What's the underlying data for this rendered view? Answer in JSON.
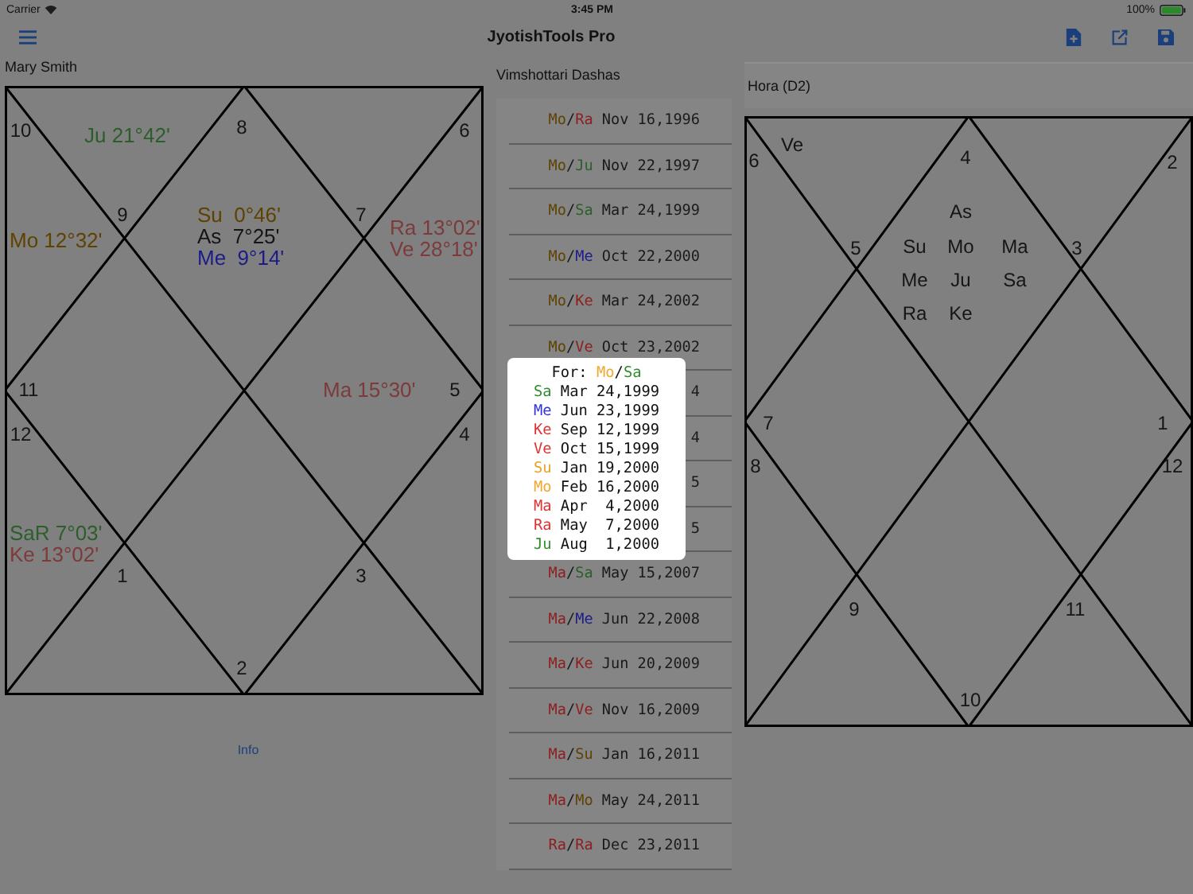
{
  "status_bar": {
    "carrier": "Carrier",
    "time": "3:45 PM",
    "battery": "100%"
  },
  "nav": {
    "title": "JyotishTools Pro"
  },
  "person": "Mary Smith",
  "rasi_chart": {
    "labels": [
      "10",
      "8",
      "6",
      "9",
      "7",
      "11",
      "5",
      "12",
      "4",
      "1",
      "3",
      "2"
    ],
    "planet_groups": [
      {
        "lines": [
          {
            "text": "Ju 21°42'",
            "color": "#2c5e2c"
          }
        ]
      },
      {
        "lines": [
          {
            "text": "Mo 12°32'",
            "color": "#5e4200"
          }
        ]
      },
      {
        "lines": [
          {
            "text": "Su  0°46'",
            "color": "#5e4200"
          },
          {
            "text": "As  7°25'",
            "color": "#151515"
          },
          {
            "text": "Me  9°14'",
            "color": "#1c1c88"
          }
        ]
      },
      {
        "lines": [
          {
            "text": "Ra 13°02'",
            "color": "#7c3a3a"
          },
          {
            "text": "Ve 28°18'",
            "color": "#7c3a3a"
          }
        ]
      },
      {
        "lines": [
          {
            "text": "Ma 15°30'",
            "color": "#7c3a3a"
          }
        ]
      },
      {
        "lines": [
          {
            "text": "SaR 7°03'",
            "color": "#2c5e2c"
          },
          {
            "text": "Ke 13°02'",
            "color": "#7c3a3a"
          }
        ]
      }
    ]
  },
  "info_link": "Info",
  "dashas": {
    "title": "Vimshottari Dashas",
    "separator": "/",
    "rows": [
      {
        "major": {
          "text": "Mo",
          "color": "#5e4200"
        },
        "minor": {
          "text": "Ra",
          "color": "#8c2020"
        },
        "date": "Nov 16,1996"
      },
      {
        "major": {
          "text": "Mo",
          "color": "#5e4200"
        },
        "minor": {
          "text": "Ju",
          "color": "#2c5e2c"
        },
        "date": "Nov 22,1997"
      },
      {
        "major": {
          "text": "Mo",
          "color": "#5e4200"
        },
        "minor": {
          "text": "Sa",
          "color": "#2c5e2c"
        },
        "date": "Mar 24,1999"
      },
      {
        "major": {
          "text": "Mo",
          "color": "#5e4200"
        },
        "minor": {
          "text": "Me",
          "color": "#1c1c88"
        },
        "date": "Oct 22,2000"
      },
      {
        "major": {
          "text": "Mo",
          "color": "#5e4200"
        },
        "minor": {
          "text": "Ke",
          "color": "#8c2020"
        },
        "date": "Mar 24,2002"
      },
      {
        "major": {
          "text": "Mo",
          "color": "#5e4200"
        },
        "minor": {
          "text": "Ve",
          "color": "#8c2020"
        },
        "date": "Oct 23,2002"
      },
      {
        "date": "4"
      },
      {
        "date": "4"
      },
      {
        "date": "5"
      },
      {
        "date": "5"
      },
      {
        "major": {
          "text": "Ma",
          "color": "#8c2020"
        },
        "minor": {
          "text": "Sa",
          "color": "#2c5e2c"
        },
        "date": "May 15,2007"
      },
      {
        "major": {
          "text": "Ma",
          "color": "#8c2020"
        },
        "minor": {
          "text": "Me",
          "color": "#1c1c88"
        },
        "date": "Jun 22,2008"
      },
      {
        "major": {
          "text": "Ma",
          "color": "#8c2020"
        },
        "minor": {
          "text": "Ke",
          "color": "#8c2020"
        },
        "date": "Jun 20,2009"
      },
      {
        "major": {
          "text": "Ma",
          "color": "#8c2020"
        },
        "minor": {
          "text": "Ve",
          "color": "#8c2020"
        },
        "date": "Nov 16,2009"
      },
      {
        "major": {
          "text": "Ma",
          "color": "#8c2020"
        },
        "minor": {
          "text": "Su",
          "color": "#5e4200"
        },
        "date": "Jan 16,2011"
      },
      {
        "major": {
          "text": "Ma",
          "color": "#8c2020"
        },
        "minor": {
          "text": "Mo",
          "color": "#5e4200"
        },
        "date": "May 24,2011"
      },
      {
        "major": {
          "text": "Ra",
          "color": "#8c2020"
        },
        "minor": {
          "text": "Ra",
          "color": "#8c2020"
        },
        "date": "Dec 23,2011"
      }
    ]
  },
  "popup": {
    "label": "For:",
    "separator": "/",
    "major": {
      "text": "Mo",
      "color": "#f0a830"
    },
    "minor": {
      "text": "Sa",
      "color": "#2e8b2e"
    },
    "rows": [
      {
        "planet": "Sa",
        "color": "#2e8b2e",
        "date": "Mar 24,1999"
      },
      {
        "planet": "Me",
        "color": "#3333dd",
        "date": "Jun 23,1999"
      },
      {
        "planet": "Ke",
        "color": "#dd3333",
        "date": "Sep 12,1999"
      },
      {
        "planet": "Ve",
        "color": "#dd3333",
        "date": "Oct 15,1999"
      },
      {
        "planet": "Su",
        "color": "#e8a020",
        "date": "Jan 19,2000"
      },
      {
        "planet": "Mo",
        "color": "#f0a830",
        "date": "Feb 16,2000"
      },
      {
        "planet": "Ma",
        "color": "#dd3333",
        "date": "Apr  4,2000"
      },
      {
        "planet": "Ra",
        "color": "#dd3333",
        "date": "May  7,2000"
      },
      {
        "planet": "Ju",
        "color": "#2e8b2e",
        "date": "Aug  1,2000"
      }
    ]
  },
  "hora_chart": {
    "title": "Hora (D2)",
    "labels": [
      "6",
      "4",
      "2",
      "5",
      "3",
      "7",
      "1",
      "8",
      "12",
      "9",
      "11",
      "10"
    ],
    "planet_groups": [
      [
        "Ve"
      ],
      [
        "As",
        "Su",
        "Mo",
        "Ma",
        "Me",
        "Ju",
        "Sa",
        "Ra",
        "Ke"
      ]
    ]
  }
}
